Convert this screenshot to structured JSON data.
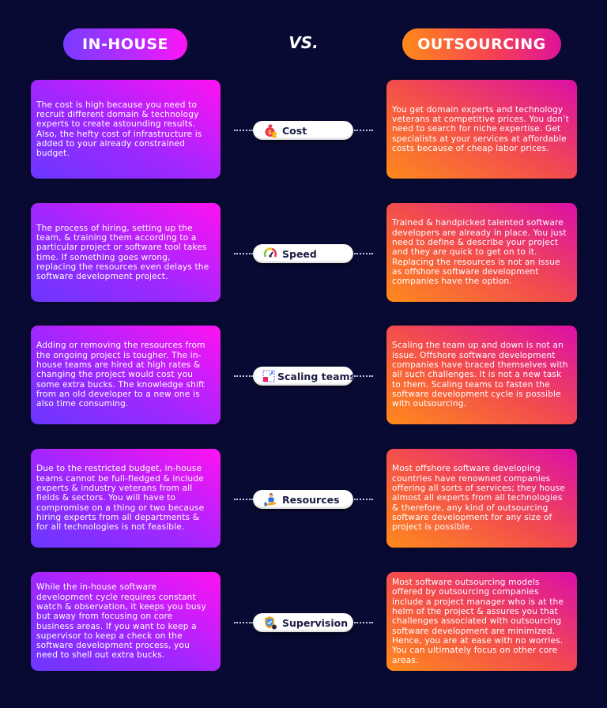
{
  "header": {
    "left_label": "IN-HOUSE",
    "vs_label": "VS.",
    "right_label": "OUTSOURCING",
    "left_gradient": [
      "#7a3bff",
      "#ff14f4"
    ],
    "right_gradient": [
      "#ff8a1c",
      "#e0129b"
    ],
    "background": "#090a33"
  },
  "rows": [
    {
      "topic": "Cost",
      "icon": "money-bag-coins-icon",
      "in_house": "The cost is high because you need to recruit different domain & technology experts to create astounding results. Also, the hefty cost of infrastructure is added to your already constrained budget.",
      "outsourcing": "You get domain experts and technology veterans at competitive prices. You don’t need to search for niche expertise. Get specialists at your services at affordable costs because of cheap labor prices."
    },
    {
      "topic": "Speed",
      "icon": "speedometer-icon",
      "in_house": "The process of hiring, setting up the team, & training them according to a particular project or software tool takes time. If something goes wrong, replacing the resources even delays the software development project.",
      "outsourcing": "Trained & handpicked talented software developers are already in place. You just need to define & describe your project and they are quick to get on to it. Replacing the resources is not an issue as offshore software development companies have the option."
    },
    {
      "topic": "Scaling teams",
      "icon": "scale-resize-icon",
      "in_house": "Adding or removing the resources from the ongoing project is tougher. The in-house teams are hired at high rates & changing the project would cost you some extra bucks. The knowledge shift from an old developer to a new one is also time consuming.",
      "outsourcing": "Scaling the team up and down is not an issue. Offshore software development companies have braced themselves with all such challenges. It is not a new task to them. Scaling teams to fasten the software development cycle is possible with outsourcing."
    },
    {
      "topic": "Resources",
      "icon": "person-on-hand-icon",
      "in_house": "Due to the restricted budget, in-house teams cannot be full-fledged & include experts & industry veterans from all fields & sectors. You will have to compromise on a thing or two because hiring experts from all departments & for all technologies is not feasible.",
      "outsourcing": "Most offshore software developing countries have renowned companies offering all sorts of services; they house almost all experts from all technologies & therefore, any kind of outsourcing software development for any size of project is possible."
    },
    {
      "topic": "Supervision",
      "icon": "shield-check-icon",
      "in_house": "While the in-house software development cycle requires constant watch & observation, it keeps you busy but away from focusing on core business areas. If you want to keep a supervisor to keep a check on the software development process, you need to shell out extra bucks.",
      "outsourcing": "Most software outsourcing models offered by outsourcing companies include a project manager who is at the helm of the project & assures you that challenges associated with outsourcing software development are minimized. Hence, you are at ease with no worries. You can ultimately focus on other core areas."
    }
  ]
}
